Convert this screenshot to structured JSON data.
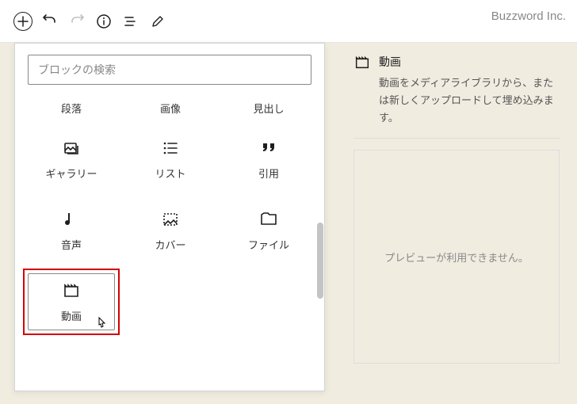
{
  "brand": "Buzzword Inc.",
  "search": {
    "placeholder": "ブロックの検索"
  },
  "blocks": {
    "row0": [
      "段落",
      "画像",
      "見出し"
    ],
    "gallery": "ギャラリー",
    "list": "リスト",
    "quote": "引用",
    "audio": "音声",
    "cover": "カバー",
    "file": "ファイル",
    "video": "動画"
  },
  "side": {
    "title": "動画",
    "desc": "動画をメディアライブラリから、または新しくアップロードして埋め込みます。",
    "preview": "プレビューが利用できません。"
  }
}
